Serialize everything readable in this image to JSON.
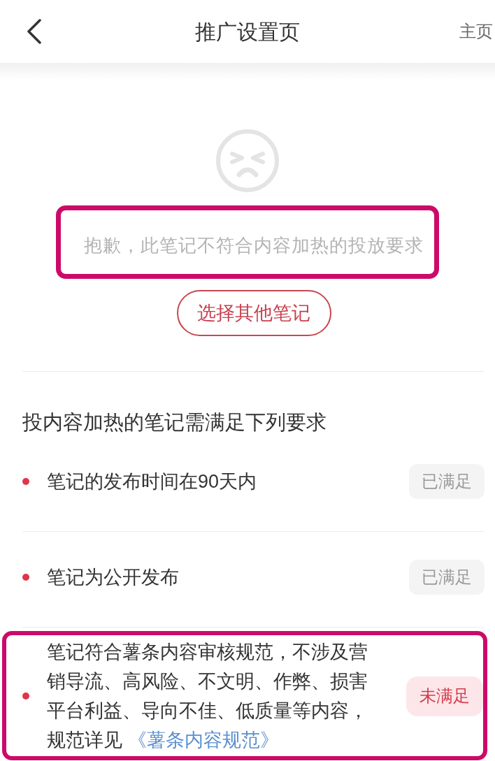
{
  "header": {
    "title": "推广设置页",
    "action": "主页"
  },
  "notice": {
    "message": "抱歉，此笔记不符合内容加热的投放要求",
    "highlighted": true,
    "button": "选择其他笔记"
  },
  "requirements_title": "投内容加热的笔记需满足下列要求",
  "requirements": [
    {
      "text": "笔记的发布时间在90天内",
      "status": "已满足",
      "met": true,
      "highlighted": false
    },
    {
      "text": "笔记为公开发布",
      "status": "已满足",
      "met": true,
      "highlighted": false
    },
    {
      "text": "笔记符合薯条内容审核规范，不涉及营销导流、高风险、不文明、作弊、损害平台利益、导向不佳、低质量等内容，规范详见",
      "link": "《薯条内容规范》",
      "status": "未满足",
      "met": false,
      "highlighted": true
    }
  ]
}
